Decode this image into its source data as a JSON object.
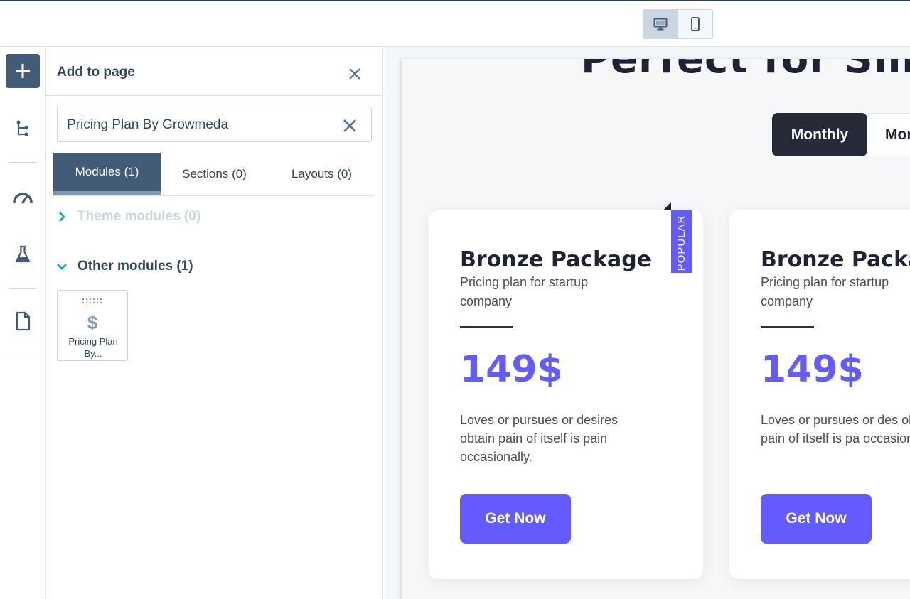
{
  "toolbar": {
    "devices": [
      {
        "icon": "desktop-icon",
        "active": true
      },
      {
        "icon": "mobile-icon",
        "active": false
      }
    ]
  },
  "rail": {
    "icons": [
      "add-icon",
      "tree-icon",
      "speedometer-icon",
      "flask-icon",
      "file-icon"
    ]
  },
  "panel": {
    "title": "Add to page",
    "search": {
      "value": "Pricing Plan By Growmeda"
    },
    "tabs": [
      {
        "label": "Modules (1)",
        "active": true
      },
      {
        "label": "Sections (0)",
        "active": false
      },
      {
        "label": "Layouts (0)",
        "active": false
      }
    ],
    "groups": {
      "theme": {
        "label": "Theme modules (0)",
        "expanded": false
      },
      "other": {
        "label": "Other modules (1)",
        "expanded": true
      }
    },
    "module": {
      "icon": "$",
      "name": "Pricing Plan By..."
    }
  },
  "preview": {
    "heading": "Perfect for Small a",
    "billing_toggle": {
      "active": "Monthly",
      "inactive": "Mor"
    },
    "cards": [
      {
        "title": "Bronze Package",
        "subtitle": "Pricing plan for startup company",
        "price": "149$",
        "description": "Loves or pursues or desires obtain pain of itself is pain occasionally.",
        "button": "Get Now",
        "badge": "POPULAR"
      },
      {
        "title": "Bronze Packag",
        "subtitle": "Pricing plan for startup company",
        "price": "149$",
        "description": "Loves or pursues or des obtain pain of itself is pa occasionally.",
        "button": "Get Now"
      }
    ],
    "colors": {
      "accent": "#635bff",
      "dark": "#252a38"
    }
  }
}
